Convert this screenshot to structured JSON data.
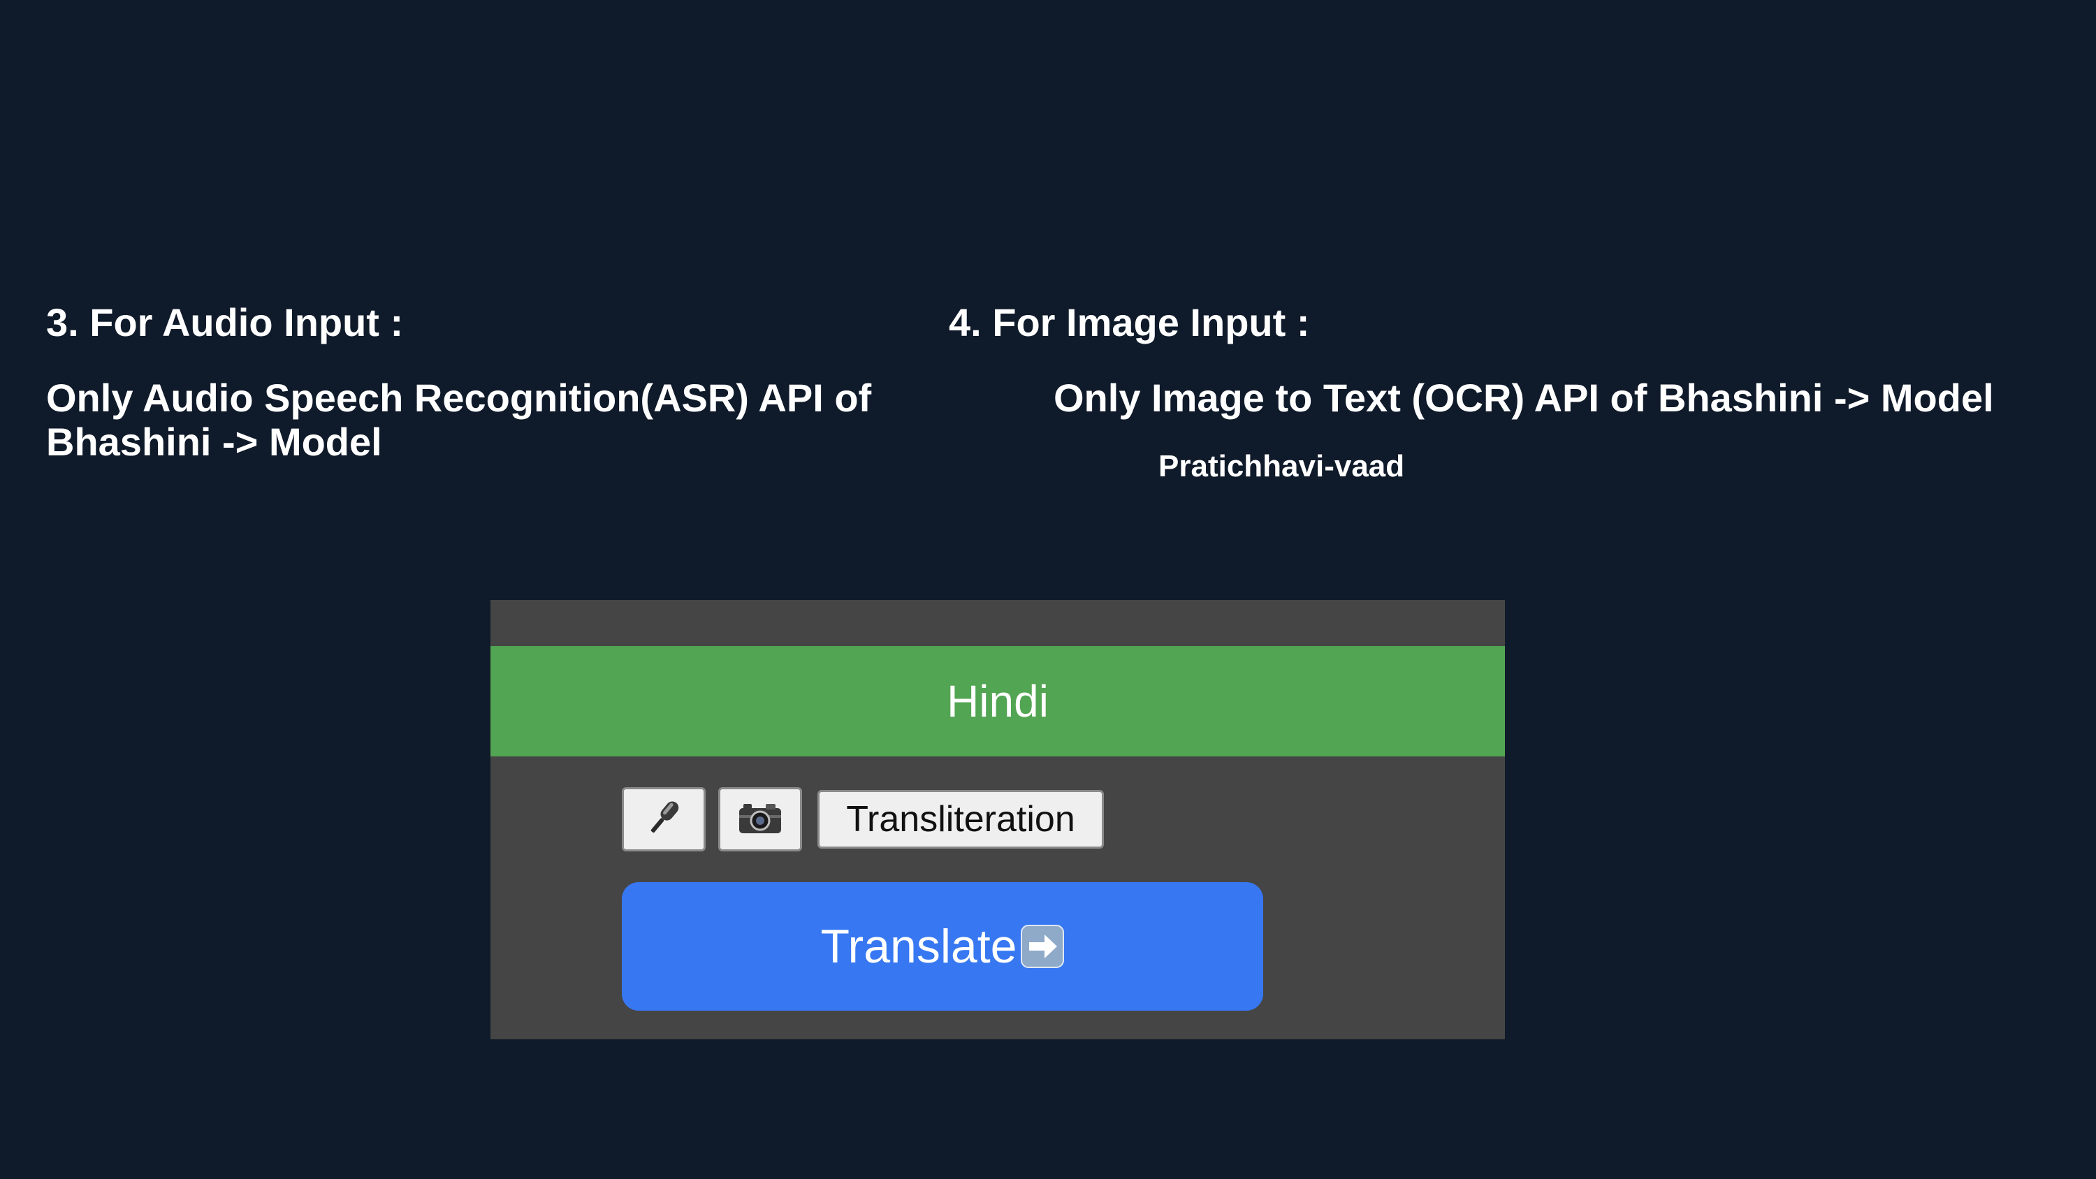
{
  "sections": {
    "audio": {
      "heading": "3. For Audio Input :",
      "description": "Only Audio Speech Recognition(ASR) API of Bhashini -> Model"
    },
    "image": {
      "heading": "4. For Image Input :",
      "description": "Only Image to Text (OCR) API of Bhashini -> Model",
      "model_name": "Pratichhavi-vaad"
    }
  },
  "app": {
    "language": "Hindi",
    "toolbar": {
      "mic_icon": "microphone-icon",
      "camera_icon": "camera-icon",
      "transliteration_label": "Transliteration"
    },
    "translate": {
      "label": "Translate",
      "icon": "right-arrow-icon"
    }
  },
  "colors": {
    "background": "#0f1a2a",
    "panel": "#454545",
    "language_bar": "#52a552",
    "translate_button": "#3778f2"
  }
}
